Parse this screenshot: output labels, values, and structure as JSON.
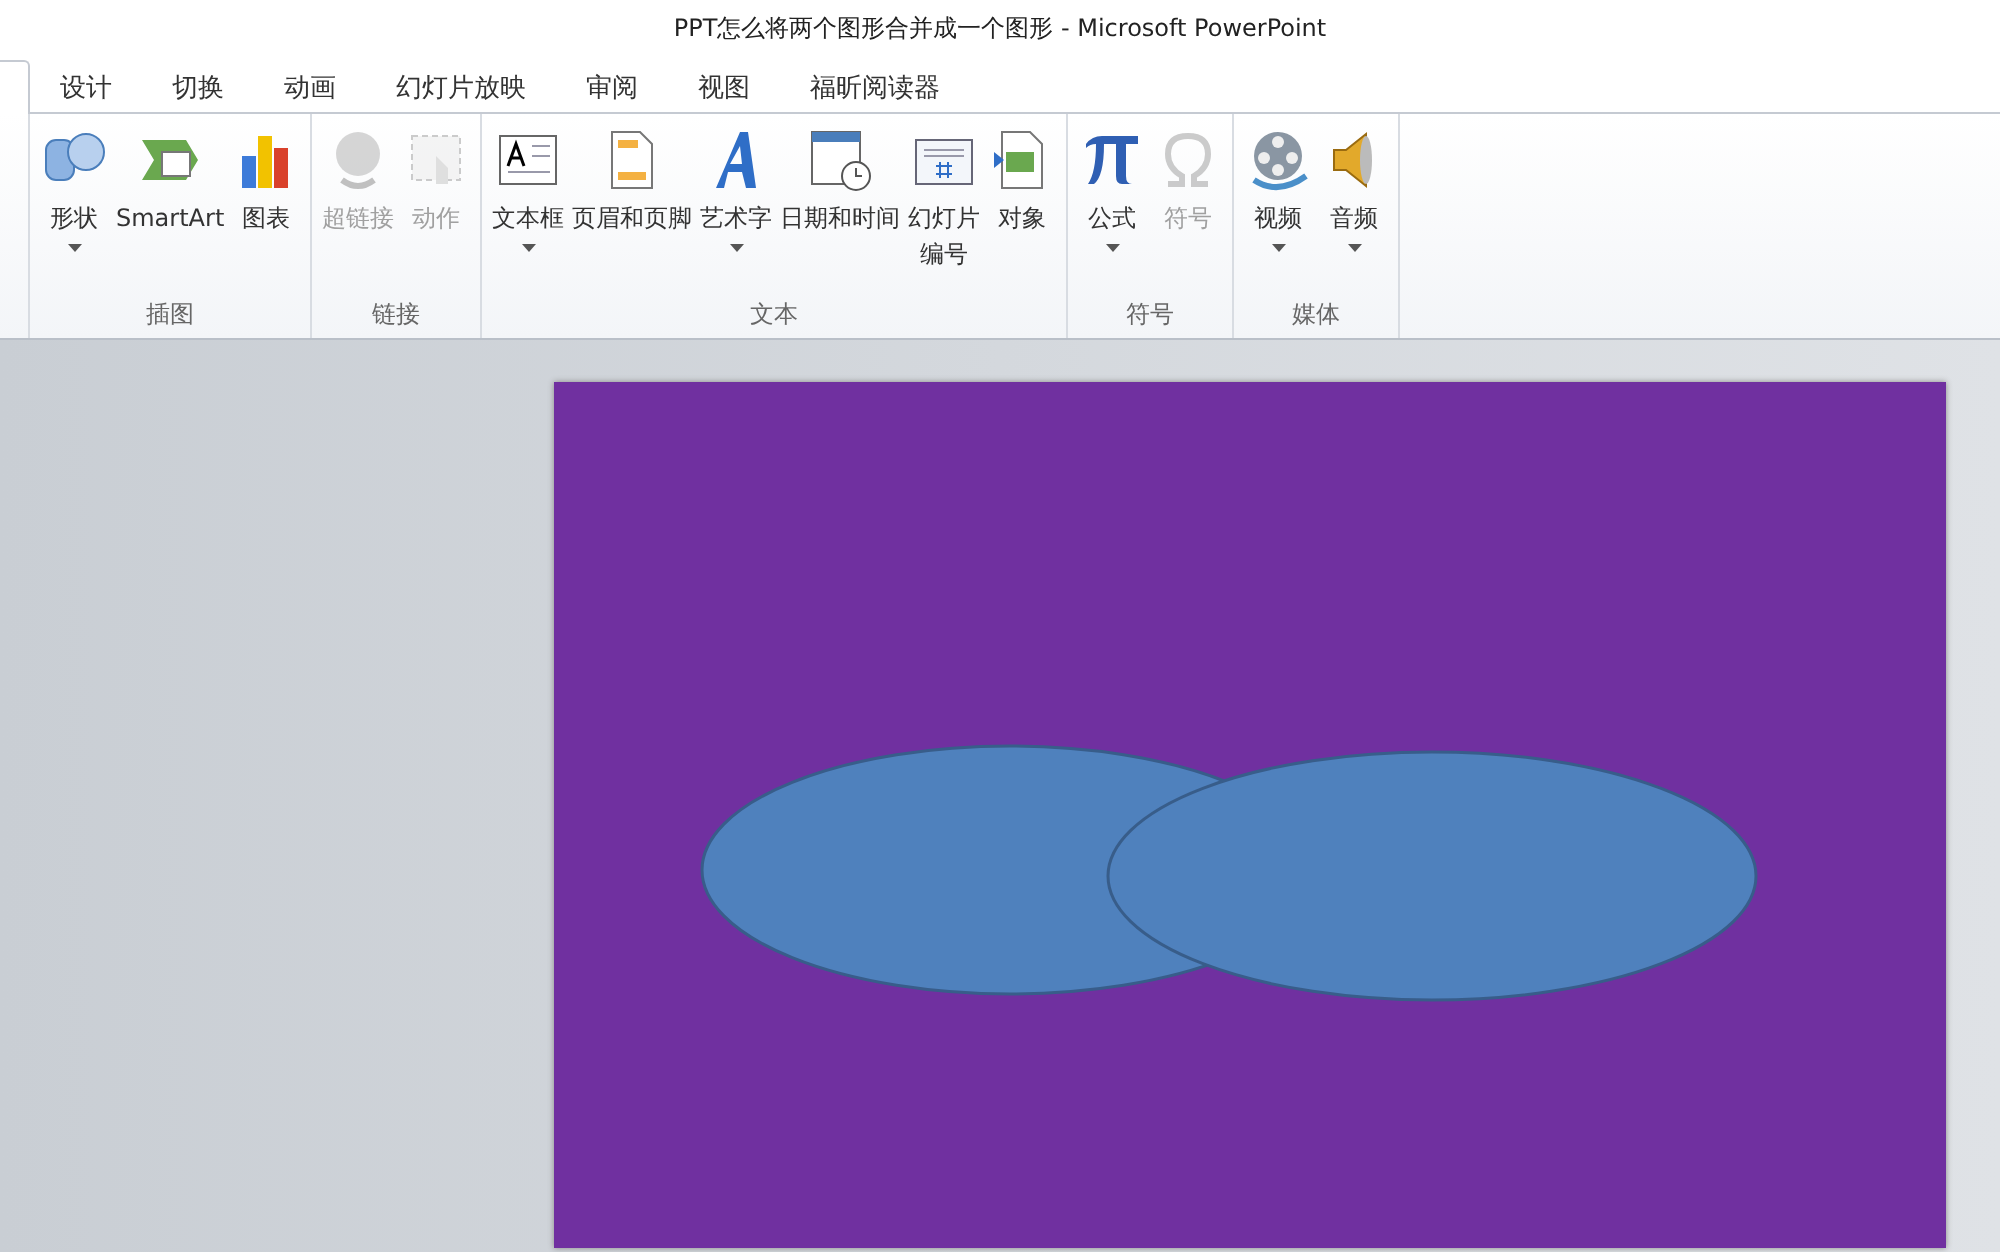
{
  "window": {
    "title": "PPT怎么将两个图形合并成一个图形 - Microsoft PowerPoint"
  },
  "tabs": [
    {
      "label": "设计",
      "selected": false
    },
    {
      "label": "切换",
      "selected": false
    },
    {
      "label": "动画",
      "selected": false
    },
    {
      "label": "幻灯片放映",
      "selected": false
    },
    {
      "label": "审阅",
      "selected": false
    },
    {
      "label": "视图",
      "selected": false
    },
    {
      "label": "福昕阅读器",
      "selected": false
    }
  ],
  "ribbon_groups": [
    {
      "label": "插图",
      "items": [
        {
          "label": "形状",
          "disabled": false,
          "has_menu": true
        },
        {
          "label": "SmartArt",
          "disabled": false,
          "has_menu": false
        },
        {
          "label": "图表",
          "disabled": false,
          "has_menu": false
        }
      ]
    },
    {
      "label": "链接",
      "items": [
        {
          "label": "超链接",
          "disabled": true,
          "has_menu": false
        },
        {
          "label": "动作",
          "disabled": true,
          "has_menu": false
        }
      ]
    },
    {
      "label": "文本",
      "items": [
        {
          "label": "文本框",
          "disabled": false,
          "has_menu": true
        },
        {
          "label": "页眉和页脚",
          "disabled": false,
          "has_menu": false
        },
        {
          "label": "艺术字",
          "disabled": false,
          "has_menu": true
        },
        {
          "label": "日期和时间",
          "disabled": false,
          "has_menu": false
        },
        {
          "label": "幻灯片",
          "label_line_2": "编号",
          "disabled": false,
          "has_menu": false
        },
        {
          "label": "对象",
          "disabled": false,
          "has_menu": false
        }
      ]
    },
    {
      "label": "符号",
      "items": [
        {
          "label": "公式",
          "disabled": false,
          "has_menu": true
        },
        {
          "label": "符号",
          "disabled": true,
          "has_menu": false
        }
      ]
    },
    {
      "label": "媒体",
      "items": [
        {
          "label": "视频",
          "disabled": false,
          "has_menu": true
        },
        {
          "label": "音频",
          "disabled": false,
          "has_menu": true
        }
      ]
    }
  ]
}
